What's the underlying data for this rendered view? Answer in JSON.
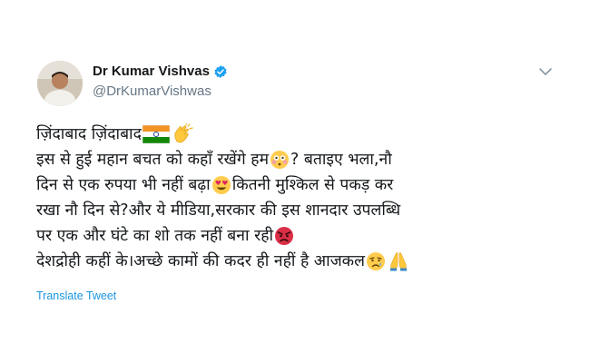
{
  "author": {
    "name": "Dr Kumar Vishvas",
    "handle": "@DrKumarVishwas",
    "verified_color": "#1da1f2"
  },
  "tweet": {
    "line1": "ज़िंदाबाद ज़िंदाबाद",
    "line2a": "इस से हुई महान बचत को कहाँ रखेंगे हम",
    "line2b": "? बताइए भला,नौ",
    "line3a": "दिन से एक रुपया भी नहीं बढ़ा",
    "line3b": "कितनी मुश्किल से पकड़ कर",
    "line4": "रखा नौ दिन से?और ये मीडिया,सरकार की इस शानदार उपलब्धि",
    "line5": "पर एक और घंटे का शो तक नहीं बना रही",
    "line6": "देशद्रोही कहीं के।अच्छे कामों की कदर ही नहीं है आजकल",
    "emojis": [
      "india-flag",
      "clapping-hands",
      "flushed-face",
      "heart-eyes-face",
      "angry-face",
      "crying-face",
      "folded-hands"
    ]
  },
  "translate_label": "Translate Tweet",
  "colors": {
    "link": "#1b95e0",
    "secondary": "#657786",
    "text": "#14171a"
  }
}
